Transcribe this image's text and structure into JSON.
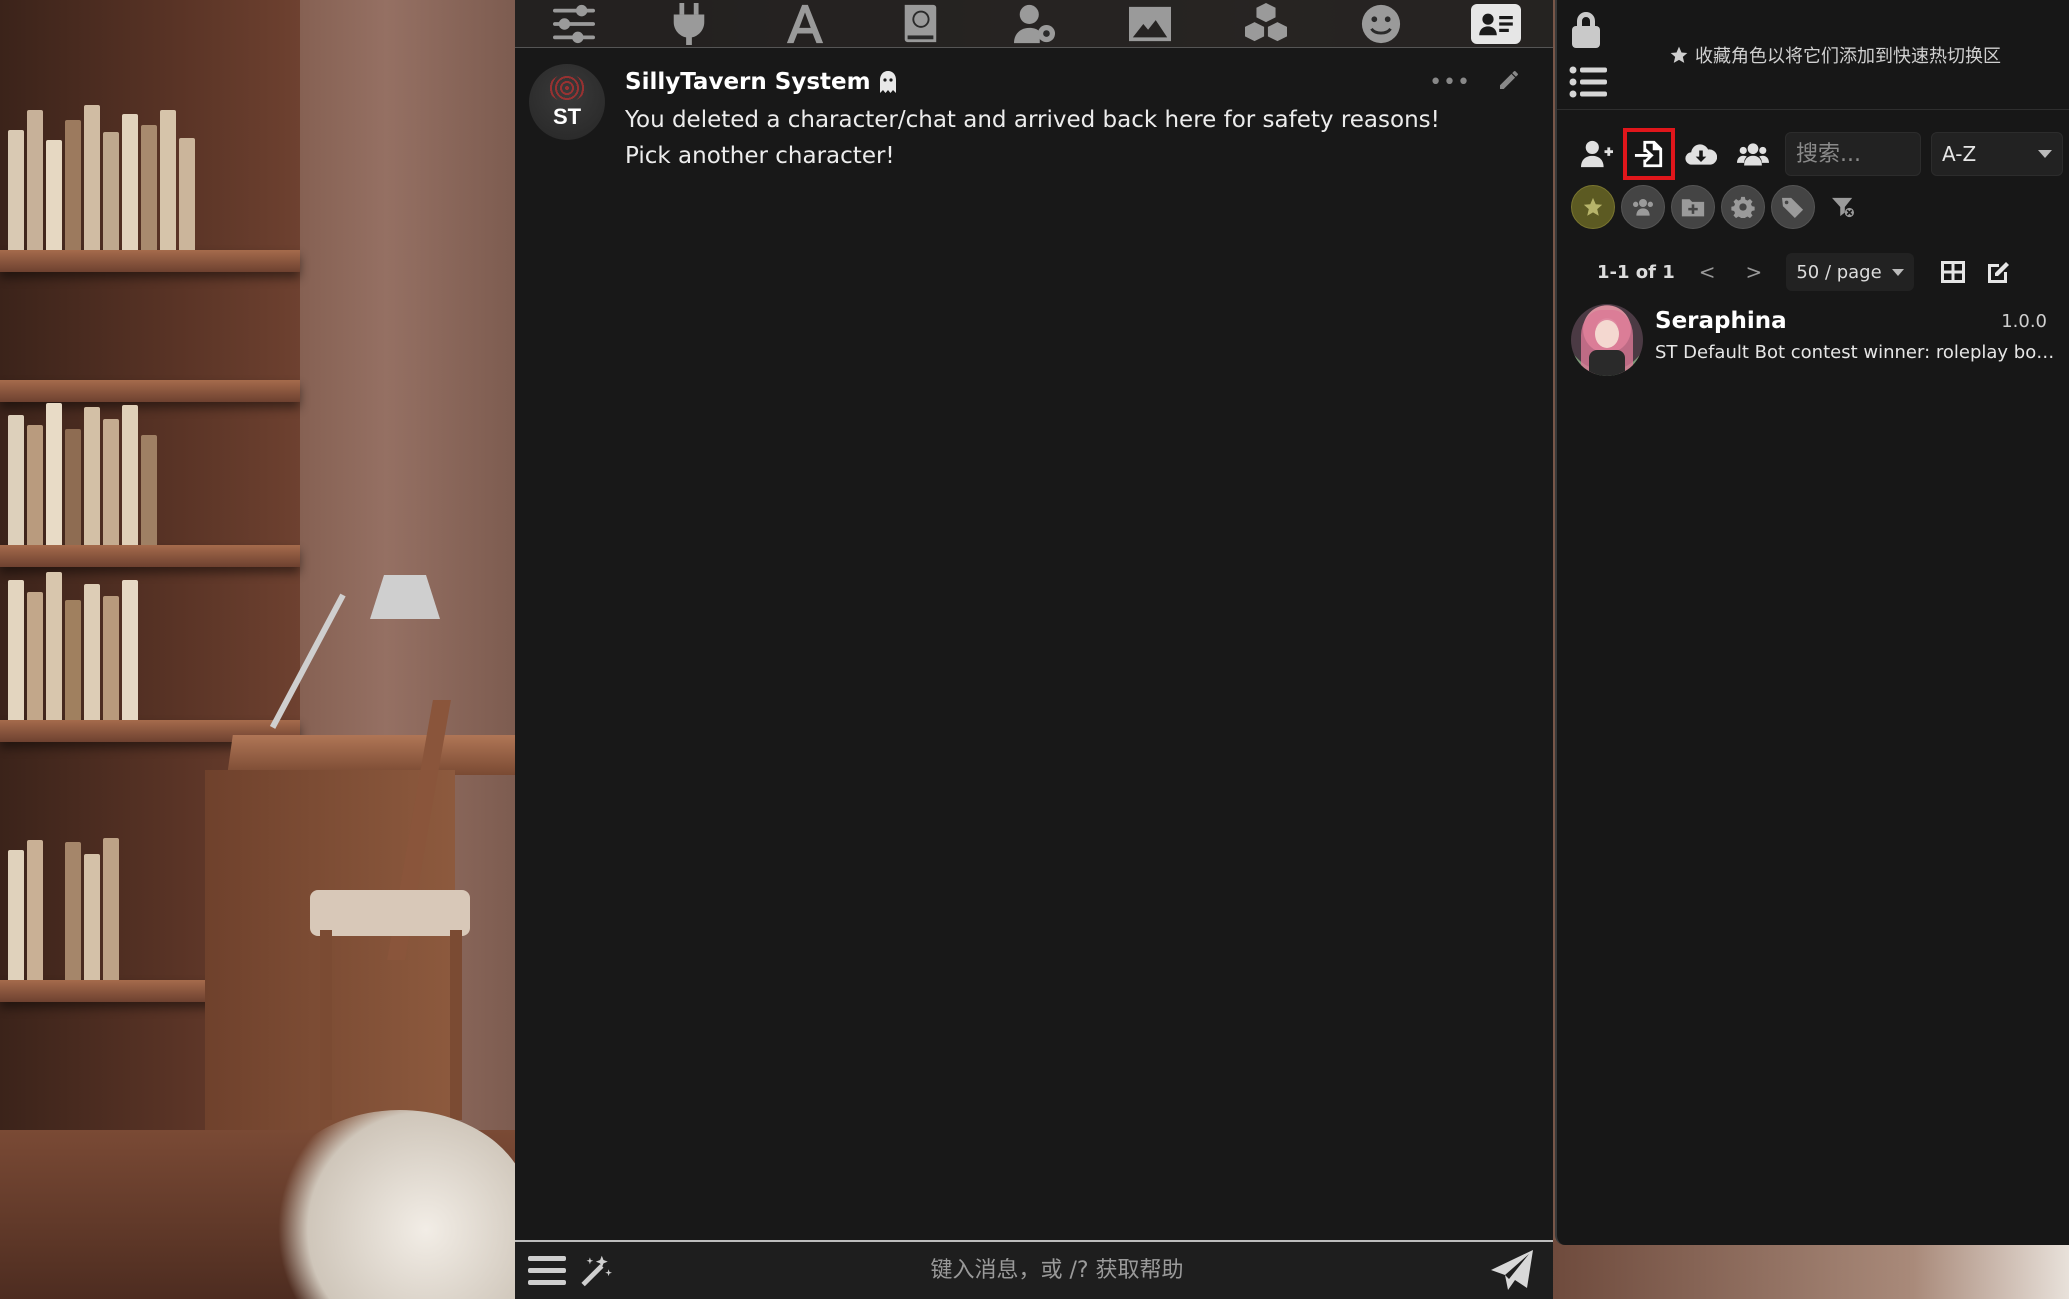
{
  "colors": {
    "panel_bg": "#171717",
    "chat_bg": "#181818",
    "highlight": "#e0161b",
    "favorite_chip": "#5c5a22"
  },
  "top_nav": {
    "icons": [
      "sliders-icon",
      "plug-icon",
      "font-icon",
      "book-globe-icon",
      "user-gear-icon",
      "image-icon",
      "cubes-icon",
      "smile-icon",
      "id-card-icon"
    ],
    "active": "id-card-icon"
  },
  "message": {
    "avatar_text": "ST",
    "author": "SillyTavern System",
    "text": "You deleted a character/chat and arrived back here for safety reasons! Pick another character!",
    "more_icon": "ellipsis-icon",
    "edit_icon": "pencil-icon"
  },
  "composer": {
    "placeholder": "键入消息，或 /? 获取帮助"
  },
  "right_panel": {
    "favorites_hint": "收藏角色以将它们添加到快速热切换区",
    "search_placeholder": "搜索...",
    "sort_value": "A-Z",
    "toolbar_icons": [
      "user-plus-icon",
      "file-import-icon",
      "cloud-download-icon",
      "users-icon"
    ],
    "highlighted_button": "file-import-icon",
    "filter_icons": [
      "star-icon",
      "group-icon",
      "folder-plus-icon",
      "gear-icon",
      "tags-icon",
      "filter-clear-icon"
    ],
    "pager": {
      "count": "1-1 of 1",
      "prev": "<",
      "next": ">",
      "per_page": "50 / page"
    }
  },
  "characters": [
    {
      "name": "Seraphina",
      "version": "1.0.0",
      "description": "ST Default Bot contest winner: roleplay bot..."
    }
  ]
}
